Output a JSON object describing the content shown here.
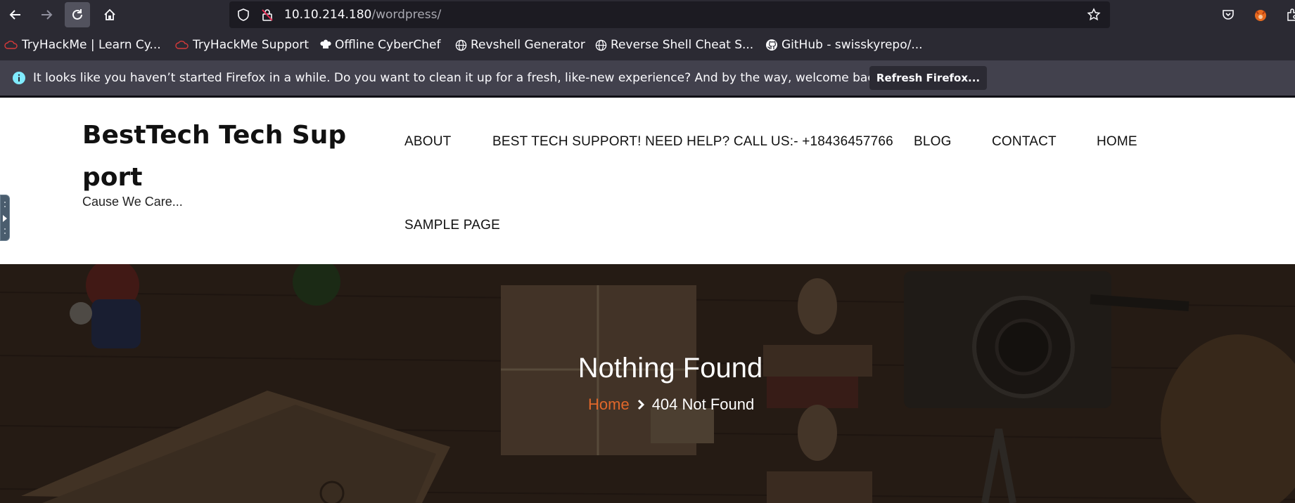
{
  "browser": {
    "url_host": "10.10.214.180",
    "url_path": "/wordpress/",
    "bookmarks": [
      {
        "label": "TryHackMe | Learn Cy...",
        "icon": "cloud-icon"
      },
      {
        "label": "TryHackMe Support",
        "icon": "cloud-icon"
      },
      {
        "label": "Offline CyberChef",
        "icon": "chef-hat-icon"
      },
      {
        "label": "Revshell Generator",
        "icon": "globe-icon"
      },
      {
        "label": "Reverse Shell Cheat S...",
        "icon": "globe-icon"
      },
      {
        "label": "GitHub - swisskyrepo/...",
        "icon": "github-icon"
      }
    ],
    "notification": {
      "message": "It looks like you haven’t started Firefox in a while. Do you want to clean it up for a fresh, like-new experience? And by the way, welcome back!",
      "button": "Refresh Firefox..."
    }
  },
  "site": {
    "title": "BestTech Tech Support",
    "tagline": "Cause We Care...",
    "menu": [
      "ABOUT",
      "BEST TECH SUPPORT! NEED HELP? CALL US:- +18436457766",
      "BLOG",
      "CONTACT",
      "HOME",
      "SAMPLE PAGE"
    ]
  },
  "hero": {
    "title": "Nothing Found",
    "breadcrumb_home": "Home",
    "breadcrumb_current": "404 Not Found"
  },
  "colors": {
    "accent": "#e0672a",
    "toolbar": "#2b2a33",
    "notice": "#42414d"
  }
}
